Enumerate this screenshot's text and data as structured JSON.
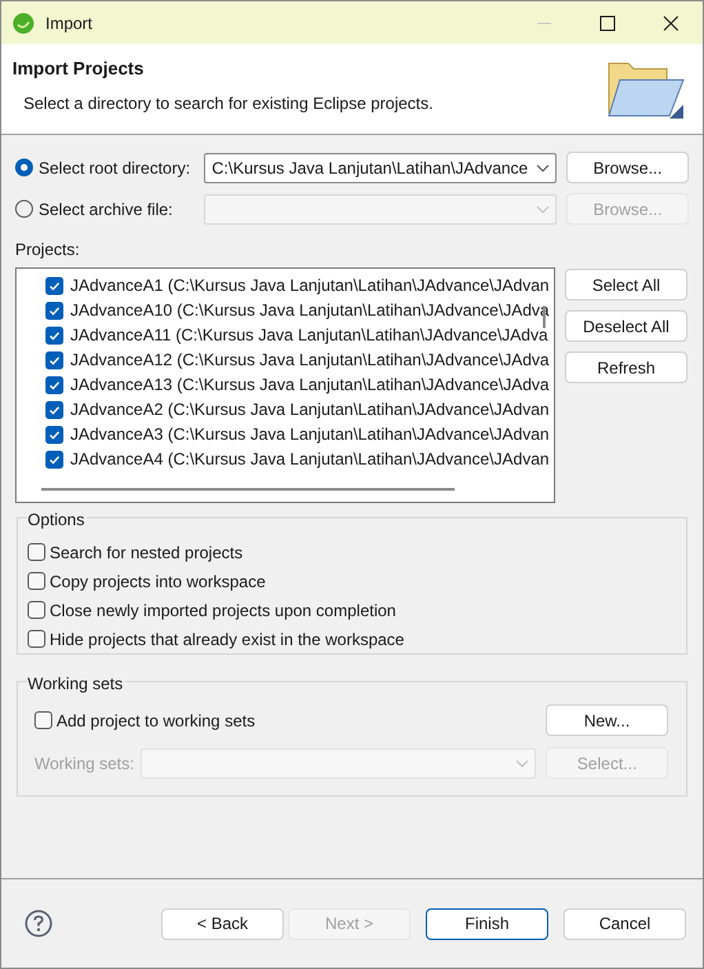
{
  "window": {
    "title": "Import"
  },
  "header": {
    "title": "Import Projects",
    "description": "Select a directory to search for existing Eclipse projects."
  },
  "source": [
    {
      "label": "Select root directory:",
      "selected": true,
      "value": "C:\\Kursus Java Lanjutan\\Latihan\\JAdvance",
      "disabled": false,
      "button": "Browse..."
    },
    {
      "label": "Select archive file:",
      "selected": false,
      "disabled": true,
      "button": "Browse..."
    }
  ],
  "projects": {
    "label": "Projects:",
    "items": [
      {
        "label": "JAdvanceA1 (C:\\Kursus Java Lanjutan\\Latihan\\JAdvance\\JAdvan",
        "checked": true
      },
      {
        "label": "JAdvanceA10 (C:\\Kursus Java Lanjutan\\Latihan\\JAdvance\\JAdva",
        "checked": true
      },
      {
        "label": "JAdvanceA11 (C:\\Kursus Java Lanjutan\\Latihan\\JAdvance\\JAdva",
        "checked": true
      },
      {
        "label": "JAdvanceA12 (C:\\Kursus Java Lanjutan\\Latihan\\JAdvance\\JAdva",
        "checked": true
      },
      {
        "label": "JAdvanceA13 (C:\\Kursus Java Lanjutan\\Latihan\\JAdvance\\JAdva",
        "checked": true
      },
      {
        "label": "JAdvanceA2 (C:\\Kursus Java Lanjutan\\Latihan\\JAdvance\\JAdvan",
        "checked": true
      },
      {
        "label": "JAdvanceA3 (C:\\Kursus Java Lanjutan\\Latihan\\JAdvance\\JAdvan",
        "checked": true
      },
      {
        "label": "JAdvanceA4 (C:\\Kursus Java Lanjutan\\Latihan\\JAdvance\\JAdvan",
        "checked": true
      }
    ],
    "buttons": [
      "Select All",
      "Deselect All",
      "Refresh"
    ]
  },
  "options": {
    "title": "Options",
    "items": [
      {
        "label": "Search for nested projects",
        "checked": false
      },
      {
        "label": "Copy projects into workspace",
        "checked": false
      },
      {
        "label": "Close newly imported projects upon completion",
        "checked": false
      },
      {
        "label": "Hide projects that already exist in the workspace",
        "checked": false
      }
    ]
  },
  "working_sets": {
    "title": "Working sets",
    "add": {
      "label": "Add project to working sets",
      "checked": false
    },
    "new_button": "New...",
    "field_label": "Working sets:",
    "disabled": true,
    "select_button": "Select..."
  },
  "footer": {
    "buttons": [
      {
        "label": "< Back",
        "disabled": false,
        "default": false
      },
      {
        "label": "Next >",
        "disabled": true,
        "default": false
      },
      {
        "label": "Finish",
        "disabled": false,
        "default": true
      },
      {
        "label": "Cancel",
        "disabled": false,
        "default": false
      }
    ]
  }
}
